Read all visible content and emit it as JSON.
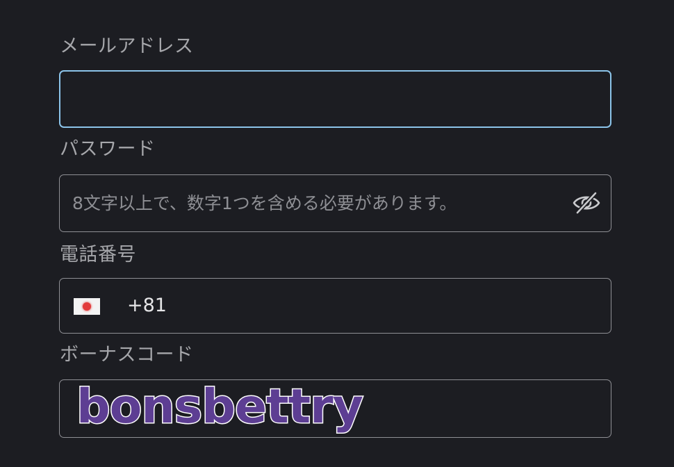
{
  "email": {
    "label": "メールアドレス",
    "value": "",
    "placeholder": ""
  },
  "password": {
    "label": "パスワード",
    "value": "",
    "placeholder": "8文字以上で、数字1つを含める必要があります。",
    "toggle_icon": "eye-slash-icon"
  },
  "phone": {
    "label": "電話番号",
    "country_flag": "japan-flag-icon",
    "dial_code": "+81"
  },
  "bonus_code": {
    "label": "ボーナスコード",
    "value": "bonsbettry"
  },
  "colors": {
    "background": "#1c1d22",
    "focus_border": "#8cc4ea",
    "border": "#8f9095",
    "label_text": "#a6a7ab",
    "watermark_fill": "#5d3e93"
  }
}
